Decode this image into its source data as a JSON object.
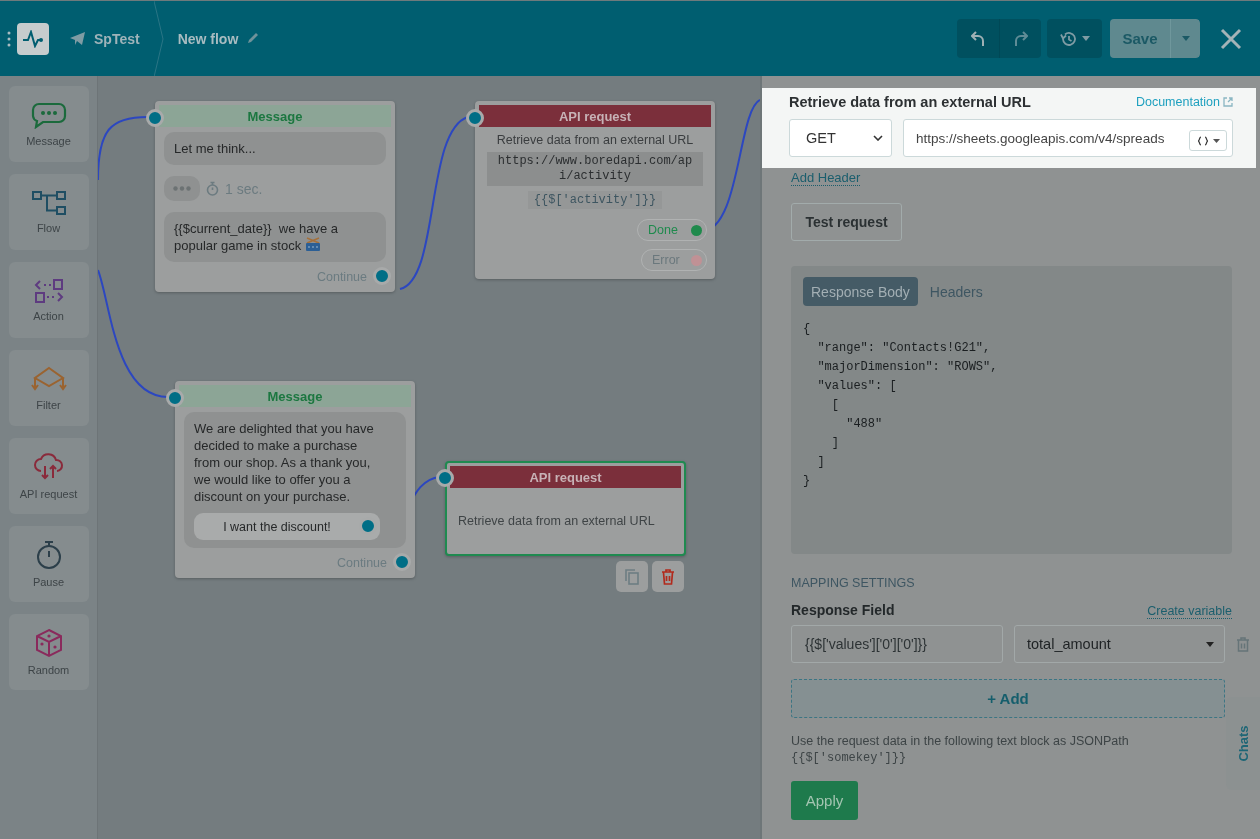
{
  "header": {
    "brand": "SpTest",
    "flow_name": "New flow",
    "save_label": "Save"
  },
  "sidebar": {
    "tools": [
      {
        "kind": "message",
        "label": "Message"
      },
      {
        "kind": "flow",
        "label": "Flow"
      },
      {
        "kind": "action",
        "label": "Action"
      },
      {
        "kind": "filter",
        "label": "Filter"
      },
      {
        "kind": "api",
        "label": "API request"
      },
      {
        "kind": "pause",
        "label": "Pause"
      },
      {
        "kind": "random",
        "label": "Random"
      }
    ]
  },
  "canvas": {
    "nodes": [
      {
        "kind": "message",
        "title": "Message",
        "selected": false,
        "bubbles": [
          {
            "kind": "text",
            "text": "Let me think..."
          },
          {
            "kind": "typing",
            "text": "1 sec."
          },
          {
            "kind": "text",
            "text": "{{$current_date}}  we have a popular game in stock"
          }
        ],
        "continue": "Continue"
      },
      {
        "kind": "api",
        "title": "API request",
        "selected": false,
        "description": "Retrieve data from an external URL",
        "url": "https://www.boredapi.com/api/activity",
        "path": "{{$['activity']}}",
        "outputs": [
          {
            "kind": "done",
            "label": "Done"
          },
          {
            "kind": "error",
            "label": "Error"
          }
        ]
      },
      {
        "kind": "message",
        "title": "Message",
        "selected": false,
        "bubbles": [
          {
            "kind": "text",
            "text": "We are delighted that you have decided to make a purchase from our shop. As a thank you, we would like to offer you a discount on your purchase.",
            "buttons": [
              "I want the discount!"
            ]
          }
        ],
        "continue": "Continue"
      },
      {
        "kind": "api",
        "title": "API request",
        "selected": true,
        "description": "Retrieve data from an external URL"
      }
    ]
  },
  "panel": {
    "title": "Retrieve data from an external URL",
    "documentation": "Documentation",
    "method": "GET",
    "url": "https://sheets.googleapis.com/v4/spreads",
    "add_header": "Add Header",
    "test_request": "Test request",
    "response_tabs": [
      {
        "label": "Response Body",
        "selected": true
      },
      {
        "label": "Headers",
        "selected": false
      }
    ],
    "response_body": [
      "{",
      "  \"range\": \"Contacts!G21\",",
      "  \"majorDimension\": \"ROWS\",",
      "  \"values\": [",
      "    [",
      "      \"488\"",
      "    ]",
      "  ]",
      "}"
    ],
    "mapping_title": "MAPPING SETTINGS",
    "response_field_label": "Response Field",
    "create_variable": "Create variable",
    "mapping": [
      {
        "field": "{{$['values']['0']['0']}}",
        "variable": "total_amount"
      }
    ],
    "add": "+ Add",
    "help": "Use the request data in the following text block as JSONPath",
    "help_code": "{{$['somekey']}}",
    "apply": "Apply"
  },
  "chats_tab": "Chats"
}
